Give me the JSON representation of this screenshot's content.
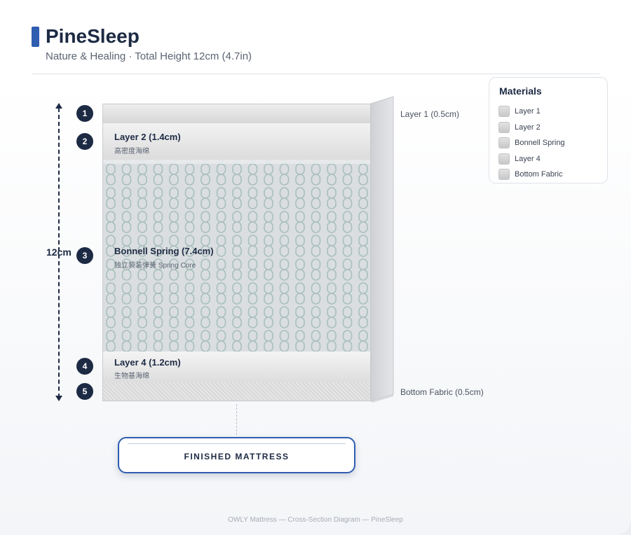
{
  "header": {
    "title": "PineSleep",
    "subtitle": "Nature & Healing · Total Height 12cm (4.7in)"
  },
  "dimension": {
    "label": "12cm"
  },
  "layers": [
    {
      "number": "1",
      "label": "",
      "sub": "",
      "callout": "Layer 1 (0.5cm)"
    },
    {
      "number": "2",
      "label": "Layer 2 (1.4cm)",
      "sub": "高密度海绵",
      "callout": ""
    },
    {
      "number": "3",
      "label": "Bonnell Spring (7.4cm)",
      "sub": "独立袋装弹簧 Spring Core",
      "callout": ""
    },
    {
      "number": "4",
      "label": "Layer 4 (1.2cm)",
      "sub": "生物基海绵",
      "callout": ""
    },
    {
      "number": "5",
      "label": "",
      "sub": "",
      "callout": "Bottom Fabric (0.5cm)"
    }
  ],
  "legend": {
    "title": "Materials",
    "items": [
      "Layer 1",
      "Layer 2",
      "Bonnell Spring",
      "Layer 4",
      "Bottom Fabric"
    ]
  },
  "result": {
    "label": "FINISHED MATTRESS"
  },
  "footer": {
    "text": "OWLY Mattress — Cross-Section Diagram — PineSleep"
  },
  "colors": {
    "accent": "#2f5db0",
    "navy": "#1d2a44",
    "spring_coil": "#a9bfbd"
  },
  "icons": {
    "spring": "coil-pattern"
  }
}
